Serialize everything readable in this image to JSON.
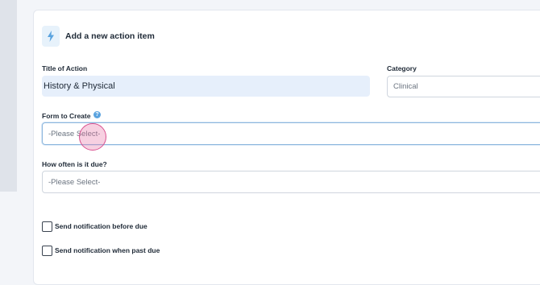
{
  "header": {
    "icon": "bolt-icon",
    "title": "Add a new action item"
  },
  "form": {
    "title_label": "Title of Action",
    "title_value": "History & Physical",
    "category_label": "Category",
    "category_value": "Clinical",
    "form_label": "Form to Create",
    "form_help_icon": "help-icon",
    "form_help_glyph": "?",
    "form_value": "-Please Select-",
    "due_label": "How often is it due?",
    "due_value": "-Please Select-",
    "notify_before_label": "Send notification before due",
    "notify_before_checked": false,
    "notify_past_label": "Send notification when past due",
    "notify_past_checked": false
  },
  "colors": {
    "accent": "#5aa3df",
    "filled_bg": "#e6effb",
    "click_indicator": "#d9508f"
  }
}
